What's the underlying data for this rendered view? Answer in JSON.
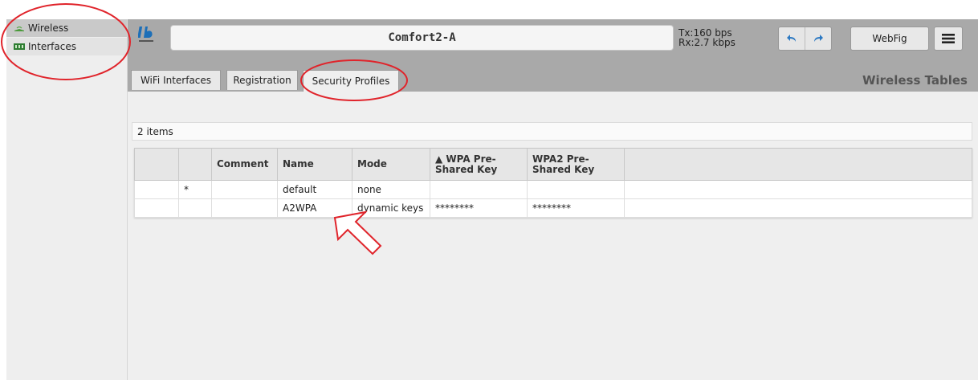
{
  "sidebar": {
    "items": [
      {
        "label": "Wireless",
        "icon": "wireless-icon"
      },
      {
        "label": "Interfaces",
        "icon": "interfaces-icon"
      }
    ]
  },
  "header": {
    "logo": "ib logo",
    "title": "Comfort2-A",
    "tx": "Tx:160 bps",
    "rx": "Rx:2.7 kbps",
    "webfig_label": "WebFig"
  },
  "tabs": [
    {
      "label": "WiFi Interfaces"
    },
    {
      "label": "Registration"
    },
    {
      "label": "Security Profiles",
      "active": true
    }
  ],
  "section_title": "Wireless Tables",
  "item_count": "2 items",
  "table": {
    "columns": [
      "",
      "",
      "Comment",
      "Name",
      "Mode",
      "▲ WPA Pre-Shared Key",
      "WPA2 Pre-Shared Key",
      ""
    ],
    "rows": [
      {
        "flag": "*",
        "comment": "",
        "name": "default",
        "mode": "none",
        "wpa": "",
        "wpa2": ""
      },
      {
        "flag": "",
        "comment": "",
        "name": "A2WPA",
        "mode": "dynamic keys",
        "wpa": "********",
        "wpa2": "********"
      }
    ]
  },
  "colors": {
    "annotation": "#e0242b",
    "toolbar": "#a9a9a9",
    "accent": "#1d6fb8"
  }
}
